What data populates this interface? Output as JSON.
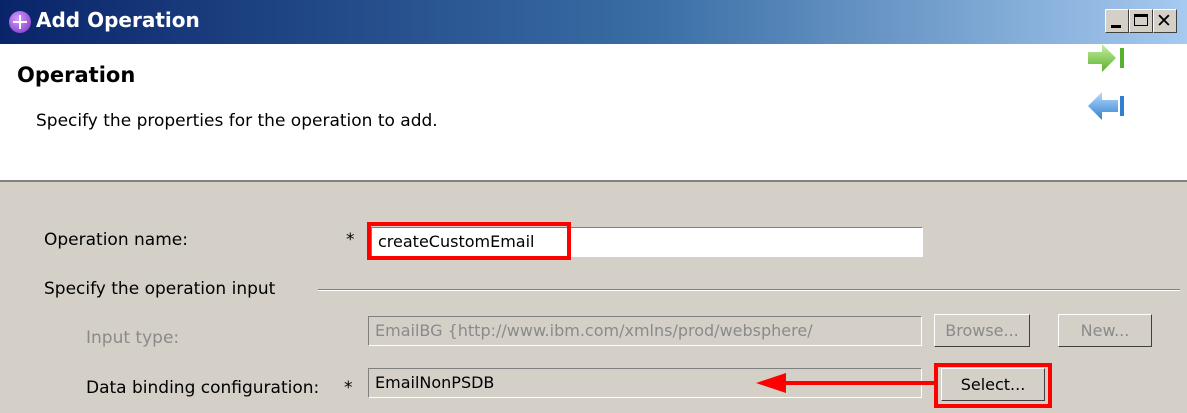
{
  "window": {
    "title": "Add Operation",
    "controls": {
      "minimize": "_",
      "maximize": "□",
      "close": "✕"
    }
  },
  "header": {
    "title": "Operation",
    "description": "Specify the properties for the operation to add."
  },
  "form": {
    "operation_name": {
      "label": "Operation name:",
      "required_mark": "*",
      "value": "createCustomEmail"
    },
    "input_section_label": "Specify the operation input",
    "input_type": {
      "label": "Input type:",
      "value": "EmailBG  {http://www.ibm.com/xmlns/prod/websphere/",
      "browse_label": "Browse...",
      "new_label": "New..."
    },
    "data_binding": {
      "label": "Data binding configuration:",
      "required_mark": "*",
      "value": "EmailNonPSDB",
      "select_label": "Select..."
    }
  },
  "annotations": {
    "highlight_color": "#ff0000"
  }
}
